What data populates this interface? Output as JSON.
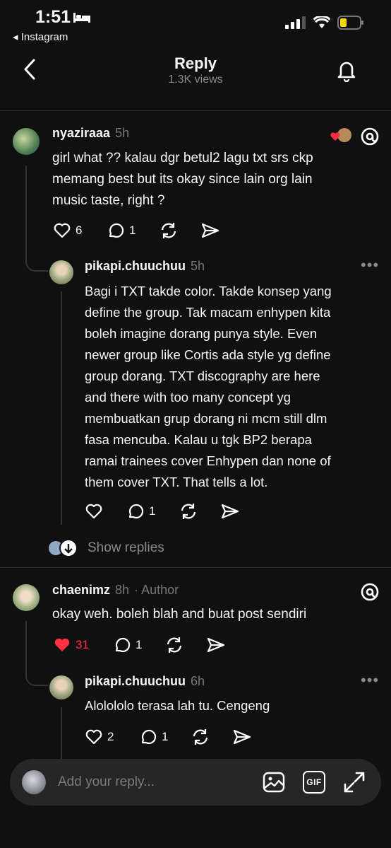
{
  "status": {
    "time": "1:51",
    "back_app": "◂ Instagram"
  },
  "header": {
    "title": "Reply",
    "views": "1.3K views"
  },
  "comments": [
    {
      "username": "nyaziraaa",
      "time": "5h",
      "text_lines": [
        "girl what ?? kalau dgr betul2 lagu txt srs ckp",
        "memang best but its okay since lain org lain",
        "music taste, right ?"
      ],
      "likes": "6",
      "replies": "1",
      "replies_nested": [
        {
          "username": "pikapi.chuuchuu",
          "time": "5h",
          "text_lines": [
            "Bagi i TXT takde color. Takde konsep yang",
            "define the group. Tak macam enhypen kita",
            "boleh imagine dorang punya style. Even",
            "newer group like Cortis ada style yg define",
            "group dorang. TXT discography are here",
            "and there with too many concept yg",
            "membuatkan grup dorang ni mcm still dlm",
            "fasa mencuba. Kalau u tgk BP2 berapa",
            "ramai trainees cover Enhypen dan none of",
            "them cover TXT. That tells a lot."
          ],
          "replies": "1",
          "show_replies": "Show replies"
        }
      ]
    },
    {
      "username": "chaenimz",
      "time": "8h",
      "author_badge": "· Author",
      "text_lines": [
        "okay weh. boleh blah and buat post sendiri"
      ],
      "likes": "31",
      "replies": "1",
      "liked_color": "#ff3040",
      "replies_nested": [
        {
          "username": "pikapi.chuuchuu",
          "time": "6h",
          "text_lines": [
            "Alolololo terasa lah tu. Cengeng"
          ],
          "likes": "2",
          "replies": "1"
        }
      ]
    }
  ],
  "reply_bar": {
    "placeholder": "Add your reply...",
    "gif_label": "GIF"
  }
}
